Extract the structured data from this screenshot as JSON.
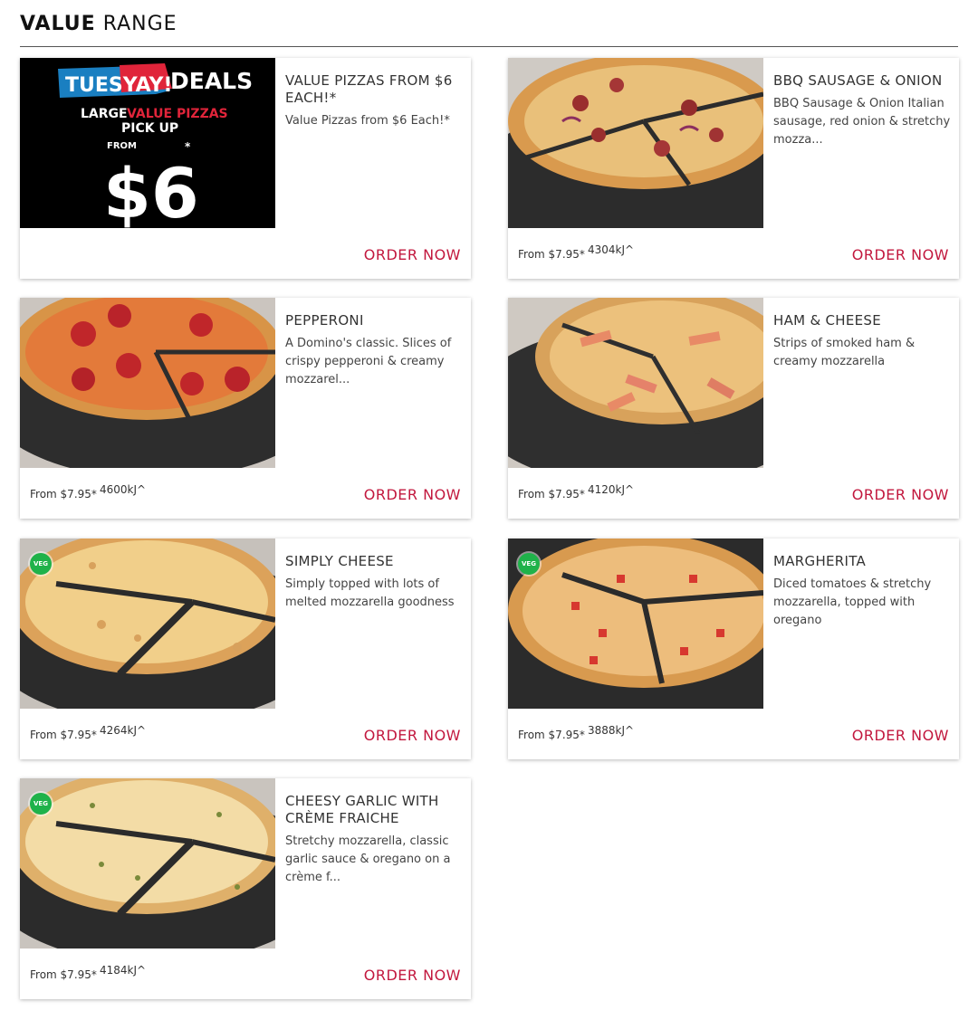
{
  "section": {
    "title_bold": "VALUE",
    "title_light": "RANGE"
  },
  "colors": {
    "accent": "#c2183e",
    "veg": "#1fb24a"
  },
  "promo_banner": {
    "brand_part1": "TUESYAY!",
    "brand_part2": "DEALS",
    "line1_a": "LARGE",
    "line1_b": "VALUE PIZZAS",
    "line2": "PICK UP",
    "from": "FROM",
    "price": "$6",
    "asterisk": "*"
  },
  "products": [
    {
      "name": "VALUE PIZZAS FROM $6 EACH!*",
      "description": "Value Pizzas from $6 Each!*",
      "price": "",
      "energy": "",
      "veg": false,
      "order_label": "ORDER NOW"
    },
    {
      "name": "BBQ SAUSAGE & ONION",
      "description": "BBQ Sausage & Onion Italian sausage, red onion & stretchy mozza...",
      "price": "From $7.95*",
      "energy": "4304kJ^",
      "veg": false,
      "order_label": "ORDER NOW"
    },
    {
      "name": "PEPPERONI",
      "description": "A Domino's classic. Slices of crispy pepperoni & creamy mozzarel...",
      "price": "From $7.95*",
      "energy": "4600kJ^",
      "veg": false,
      "order_label": "ORDER NOW"
    },
    {
      "name": "HAM & CHEESE",
      "description": "Strips of smoked ham & creamy mozzarella",
      "price": "From $7.95*",
      "energy": "4120kJ^",
      "veg": false,
      "order_label": "ORDER NOW"
    },
    {
      "name": "SIMPLY CHEESE",
      "description": "Simply topped with lots of melted mozzarella goodness",
      "price": "From $7.95*",
      "energy": "4264kJ^",
      "veg": true,
      "veg_label": "VEG",
      "order_label": "ORDER NOW"
    },
    {
      "name": "MARGHERITA",
      "description": "Diced tomatoes & stretchy mozzarella, topped with oregano",
      "price": "From $7.95*",
      "energy": "3888kJ^",
      "veg": true,
      "veg_label": "VEG",
      "order_label": "ORDER NOW"
    },
    {
      "name": "CHEESY GARLIC WITH CRÈME FRAICHE",
      "description": "Stretchy mozzarella, classic garlic sauce & oregano on a crème f...",
      "price": "From $7.95*",
      "energy": "4184kJ^",
      "veg": true,
      "veg_label": "VEG",
      "order_label": "ORDER NOW"
    }
  ]
}
